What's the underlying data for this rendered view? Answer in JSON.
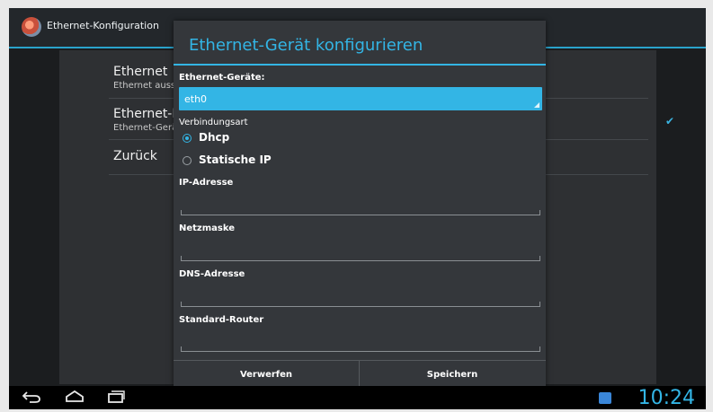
{
  "actionbar": {
    "title": "Ethernet-Konfiguration",
    "icon": "ethernet-app-icon"
  },
  "settings": {
    "items": [
      {
        "title": "Ethernet",
        "summary": "Ethernet ausse"
      },
      {
        "title": "Ethernet-K",
        "summary": "Ethernet-Gerä"
      },
      {
        "title": "Zurück",
        "summary": ""
      }
    ],
    "checkbox_checked": true
  },
  "dialog": {
    "title": "Ethernet-Gerät konfigurieren",
    "device_label": "Ethernet-Geräte:",
    "device_value": "eth0",
    "connection_label": "Verbindungsart",
    "options": [
      {
        "label": "Dhcp",
        "selected": true
      },
      {
        "label": "Statische IP",
        "selected": false
      }
    ],
    "fields": [
      {
        "label": "IP-Adresse",
        "value": ""
      },
      {
        "label": "Netzmaske",
        "value": ""
      },
      {
        "label": "DNS-Adresse",
        "value": ""
      },
      {
        "label": "Standard-Router",
        "value": ""
      }
    ],
    "cancel_label": "Verwerfen",
    "save_label": "Speichern"
  },
  "navbar": {
    "icons": [
      "back-icon",
      "home-icon",
      "recent-apps-icon"
    ],
    "time": "10:24"
  },
  "colors": {
    "accent": "#33b5e5",
    "background": "#1b1d1f",
    "dialog": "#34373b"
  }
}
